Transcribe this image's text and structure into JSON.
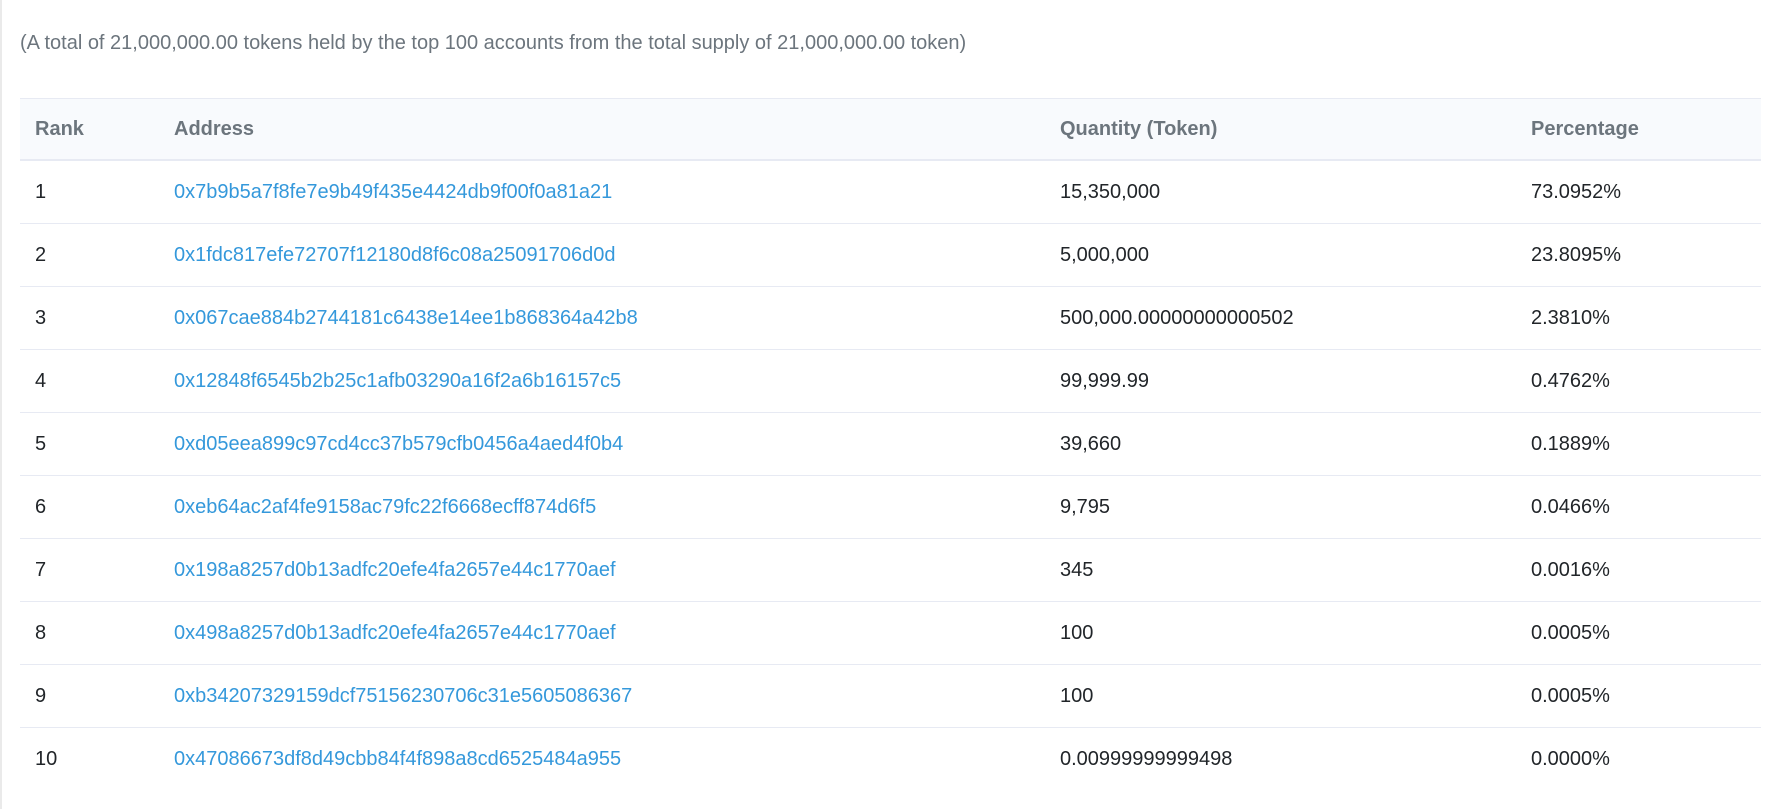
{
  "summary": "(A total of 21,000,000.00 tokens held by the top 100 accounts from the total supply of 21,000,000.00 token)",
  "table": {
    "headers": {
      "rank": "Rank",
      "address": "Address",
      "quantity": "Quantity (Token)",
      "percentage": "Percentage"
    },
    "rows": [
      {
        "rank": "1",
        "address": "0x7b9b5a7f8fe7e9b49f435e4424db9f00f0a81a21",
        "quantity": "15,350,000",
        "percentage": "73.0952%"
      },
      {
        "rank": "2",
        "address": "0x1fdc817efe72707f12180d8f6c08a25091706d0d",
        "quantity": "5,000,000",
        "percentage": "23.8095%"
      },
      {
        "rank": "3",
        "address": "0x067cae884b2744181c6438e14ee1b868364a42b8",
        "quantity": "500,000.00000000000502",
        "percentage": "2.3810%"
      },
      {
        "rank": "4",
        "address": "0x12848f6545b2b25c1afb03290a16f2a6b16157c5",
        "quantity": "99,999.99",
        "percentage": "0.4762%"
      },
      {
        "rank": "5",
        "address": "0xd05eea899c97cd4cc37b579cfb0456a4aed4f0b4",
        "quantity": "39,660",
        "percentage": "0.1889%"
      },
      {
        "rank": "6",
        "address": "0xeb64ac2af4fe9158ac79fc22f6668ecff874d6f5",
        "quantity": "9,795",
        "percentage": "0.0466%"
      },
      {
        "rank": "7",
        "address": "0x198a8257d0b13adfc20efe4fa2657e44c1770aef",
        "quantity": "345",
        "percentage": "0.0016%"
      },
      {
        "rank": "8",
        "address": "0x498a8257d0b13adfc20efe4fa2657e44c1770aef",
        "quantity": "100",
        "percentage": "0.0005%"
      },
      {
        "rank": "9",
        "address": "0xb34207329159dcf75156230706c31e5605086367",
        "quantity": "100",
        "percentage": "0.0005%"
      },
      {
        "rank": "10",
        "address": "0x47086673df8d49cbb84f4f898a8cd6525484a955",
        "quantity": "0.00999999999498",
        "percentage": "0.0000%"
      }
    ]
  },
  "colors": {
    "link": "#3498db",
    "muted_text": "#6c757d",
    "header_bg": "#f8fafd",
    "row_border": "#e7eaf3"
  }
}
